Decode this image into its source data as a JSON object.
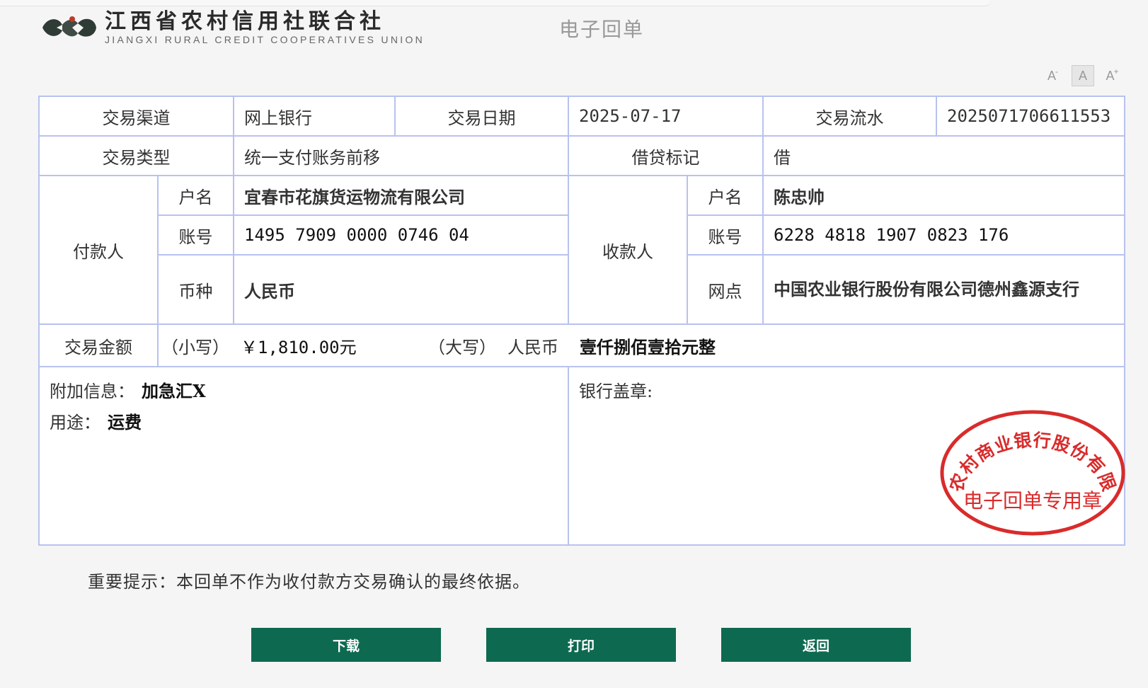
{
  "header": {
    "logo_cn": "江西省农村信用社联合社",
    "logo_en": "JIANGXI RURAL CREDIT COOPERATIVES UNION",
    "doc_title": "电子回单"
  },
  "font_tools": {
    "decrease": "A",
    "normal": "A",
    "increase": "A",
    "decrease_sign": "-",
    "increase_sign": "+"
  },
  "receipt": {
    "channel_label": "交易渠道",
    "channel_value": "网上银行",
    "date_label": "交易日期",
    "date_value": "2025-07-17",
    "serial_label": "交易流水",
    "serial_value": "2025071706611553",
    "type_label": "交易类型",
    "type_value": "统一支付账务前移",
    "dc_label": "借贷标记",
    "dc_value": "借",
    "payer": {
      "label": "付款人",
      "name_label": "户名",
      "name_value": "宜春市花旗货运物流有限公司",
      "account_label": "账号",
      "account_value": "1495 7909 0000 0746 04",
      "currency_label": "币种",
      "currency_value": "人民币"
    },
    "payee": {
      "label": "收款人",
      "name_label": "户名",
      "name_value": "陈忠帅",
      "account_label": "账号",
      "account_value": "6228 4818 1907 0823 176",
      "branch_label": "网点",
      "branch_value": "中国农业银行股份有限公司德州鑫源支行"
    },
    "amount": {
      "label": "交易金额",
      "lower_label": "（小写）",
      "lower_value": "￥1,810.00元",
      "upper_label": "（大写）",
      "upper_currency": "人民币",
      "upper_value": "壹仟捌佰壹拾元整"
    },
    "extra": {
      "label": "附加信息：",
      "value": "加急汇X",
      "purpose_label": "用途：",
      "purpose_value": "运费"
    },
    "seal": {
      "label": "银行盖章:",
      "company": "宜春农村商业银行股份有限公司",
      "subtitle": "电子回单专用章",
      "color": "#d92b2b"
    }
  },
  "notice": "重要提示：本回单不作为收付款方交易确认的最终依据。",
  "buttons": {
    "download": "下载",
    "print": "打印",
    "back": "返回",
    "color": "#0d6a50"
  }
}
